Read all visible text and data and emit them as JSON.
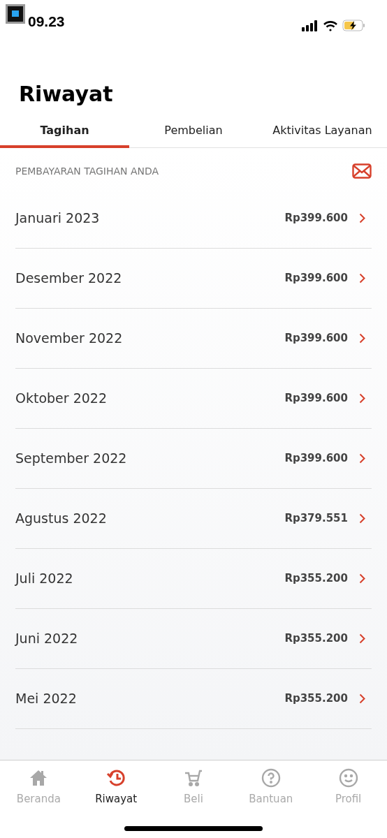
{
  "status_bar": {
    "time": "09.23"
  },
  "title": "Riwayat",
  "tabs": [
    {
      "label": "Tagihan",
      "selected": true
    },
    {
      "label": "Pembelian",
      "selected": false
    },
    {
      "label": "Aktivitas Layanan",
      "selected": false
    }
  ],
  "section": {
    "title": "PEMBAYARAN TAGIHAN ANDA"
  },
  "bills": [
    {
      "month": "Januari 2023",
      "amount": "Rp399.600"
    },
    {
      "month": "Desember 2022",
      "amount": "Rp399.600"
    },
    {
      "month": "November 2022",
      "amount": "Rp399.600"
    },
    {
      "month": "Oktober 2022",
      "amount": "Rp399.600"
    },
    {
      "month": "September 2022",
      "amount": "Rp399.600"
    },
    {
      "month": "Agustus 2022",
      "amount": "Rp379.551"
    },
    {
      "month": "Juli 2022",
      "amount": "Rp355.200"
    },
    {
      "month": "Juni 2022",
      "amount": "Rp355.200"
    },
    {
      "month": "Mei 2022",
      "amount": "Rp355.200"
    }
  ],
  "bottom_nav": [
    {
      "kind": "home",
      "label": "Beranda",
      "selected": false
    },
    {
      "kind": "history",
      "label": "Riwayat",
      "selected": true
    },
    {
      "kind": "cart",
      "label": "Beli",
      "selected": false
    },
    {
      "kind": "help",
      "label": "Bantuan",
      "selected": false
    },
    {
      "kind": "profile",
      "label": "Profil",
      "selected": false
    }
  ]
}
